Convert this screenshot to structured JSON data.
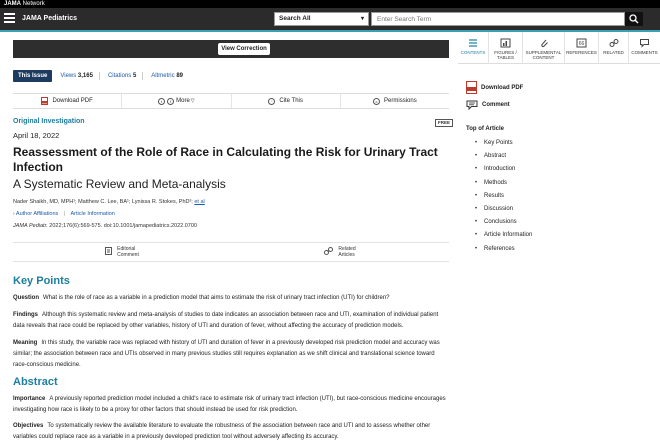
{
  "network": {
    "brand": "JAMA",
    "suffix": " Network"
  },
  "header": {
    "journal": "JAMA Pediatrics",
    "search_scope": "Search All",
    "search_placeholder": "Enter Search Term"
  },
  "correction": {
    "button": "View Correction"
  },
  "metrics": {
    "this_issue": "This Issue",
    "views_label": "Views",
    "views_value": "3,165",
    "citations_label": "Citations",
    "citations_value": "5",
    "altmetric_label": "Altmetric",
    "altmetric_value": "89"
  },
  "actions": {
    "download_pdf": "Download PDF",
    "more": "More",
    "cite_this": "Cite This",
    "permissions": "Permissions"
  },
  "article": {
    "type": "Original Investigation",
    "free": "FREE",
    "date": "April 18, 2022",
    "title": "Reassessment of the Role of Race in Calculating the Risk for Urinary Tract Infection",
    "subtitle": "A Systematic Review and Meta-analysis",
    "authors": "Nader Shaikh, MD, MPH¹; Matthew C. Lee, BA¹; Lynissa R. Stokes, PhD²;",
    "etal": "et al",
    "author_affiliations": "Author Affiliations",
    "article_information": "Article Information",
    "journal_abbrev": "JAMA Pediatr.",
    "citation_rest": " 2022;176(6):569-575. doi:10.1001/jamapediatrics.2022.0700"
  },
  "related": {
    "editorial_comment": [
      "Editorial",
      "Comment"
    ],
    "related_articles": [
      "Related",
      "Articles"
    ]
  },
  "key_points": {
    "heading": "Key Points",
    "question_label": "Question",
    "question": "What is the role of race as a variable in a prediction model that aims to estimate the risk of urinary tract infection (UTI) for children?",
    "findings_label": "Findings",
    "findings": "Although this systematic review and meta-analysis of studies to date indicates an association between race and UTI, examination of individual patient data reveals that race could be replaced by other variables, history of UTI and duration of fever, without affecting the accuracy of prediction models.",
    "meaning_label": "Meaning",
    "meaning": "In this study, the variable race was replaced with history of UTI and duration of fever in a previously developed risk prediction model and accuracy was similar; the association between race and UTIs observed in many previous studies still requires explanation as we shift clinical and translational science toward race-conscious medicine."
  },
  "abstract": {
    "heading": "Abstract",
    "importance_label": "Importance",
    "importance": "A previously reported prediction model included a child's race to estimate risk of urinary tract infection (UTI), but race-conscious medicine encourages investigating how race is likely to be a proxy for other factors that should instead be used for risk prediction.",
    "objectives_label": "Objectives",
    "objectives": "To systematically review the available literature to evaluate the robustness of the association between race and UTI and to assess whether other variables could replace race as a variable in a previously developed prediction tool without adversely affecting its accuracy."
  },
  "sidebar": {
    "tabs": [
      {
        "lines": [
          "CONTENTS"
        ],
        "icon": "contents-icon"
      },
      {
        "lines": [
          "FIGURES /",
          "TABLES"
        ],
        "icon": "figures-icon"
      },
      {
        "lines": [
          "SUPPLEMENTAL",
          "CONTENT"
        ],
        "icon": "paperclip-icon"
      },
      {
        "lines": [
          "REFERENCES"
        ],
        "icon": "references-icon"
      },
      {
        "lines": [
          "RELATED"
        ],
        "icon": "related-icon"
      },
      {
        "lines": [
          "COMMENTS"
        ],
        "icon": "comments-icon"
      }
    ],
    "download_pdf": "Download PDF",
    "comment": "Comment",
    "toc_title": "Top of Article",
    "toc": [
      "Key Points",
      "Abstract",
      "Introduction",
      "Methods",
      "Results",
      "Discussion",
      "Conclusions",
      "Article Information",
      "References"
    ]
  }
}
